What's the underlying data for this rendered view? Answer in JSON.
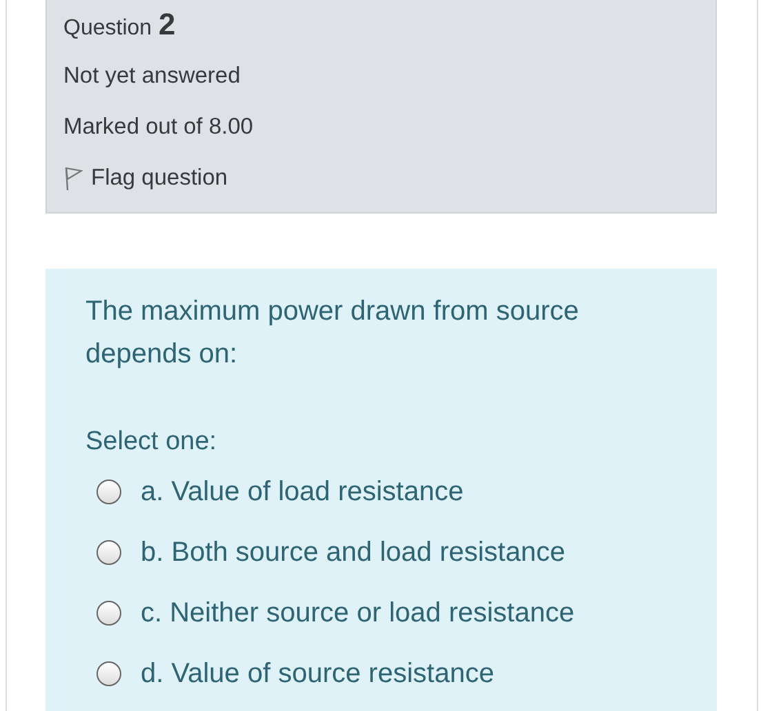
{
  "info": {
    "heading_label": "Question",
    "number": "2",
    "status": "Not yet answered",
    "marks": "Marked out of 8.00",
    "flag": {
      "label": "Flag question",
      "flagged": false
    }
  },
  "question": {
    "text": "The maximum power drawn from source depends on:",
    "prompt": "Select one:",
    "options": [
      {
        "label": "a. Value of load resistance",
        "selected": false
      },
      {
        "label": "b. Both source and load resistance",
        "selected": false
      },
      {
        "label": "c. Neither source or load resistance",
        "selected": false
      },
      {
        "label": "d. Value of source resistance",
        "selected": false
      }
    ]
  }
}
